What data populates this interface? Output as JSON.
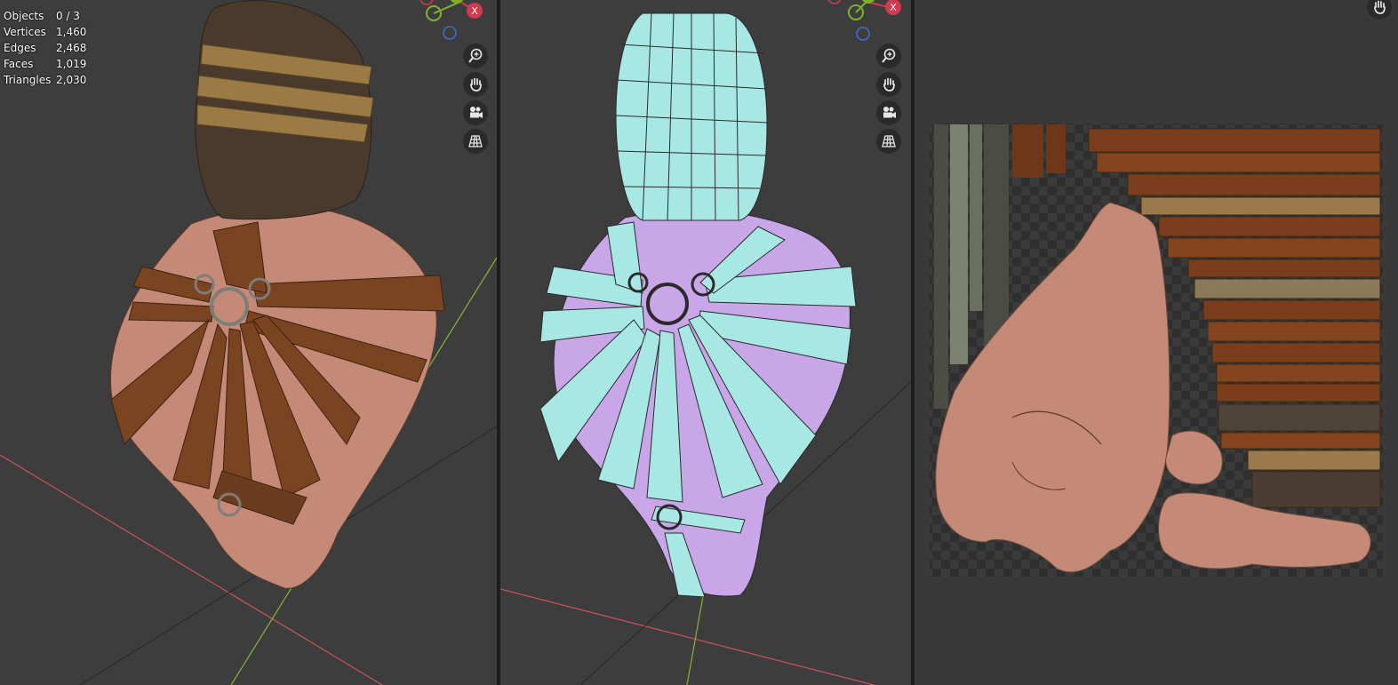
{
  "stats": {
    "rows": [
      {
        "label": "Objects",
        "value": "0 / 3"
      },
      {
        "label": "Vertices",
        "value": "1,460"
      },
      {
        "label": "Edges",
        "value": "2,468"
      },
      {
        "label": "Faces",
        "value": "1,019"
      },
      {
        "label": "Triangles",
        "value": "2,030"
      }
    ]
  },
  "gizmo": {
    "x_label": "X"
  },
  "viewport_left": {
    "shading": "material-preview"
  },
  "viewport_right": {
    "shading": "face-orientation-wireframe"
  },
  "uv_editor": {
    "tool": "hand-pan"
  },
  "colors": {
    "viewport_bg": "#3d3d3d",
    "uv_bg": "#393939",
    "axis_x": "#d4394f",
    "axis_y": "#7fb02a",
    "axis_z": "#3a6fd8",
    "skin": "#c48a77",
    "leather": "#7a4420",
    "hood": "#4a3a2c",
    "wire_front": "#a8e8e4",
    "wire_back": "#c9a6e8"
  },
  "icons": [
    "zoom-icon",
    "hand-icon",
    "camera-icon",
    "grid-icon"
  ]
}
